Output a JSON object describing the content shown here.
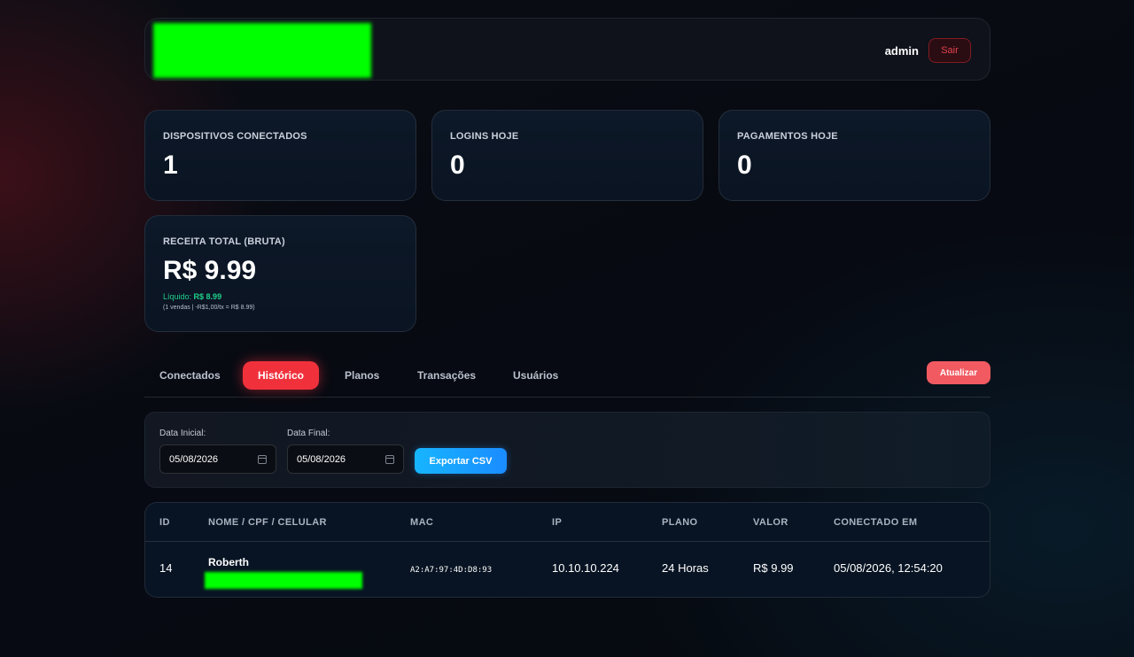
{
  "header": {
    "user": "admin",
    "logout_label": "Sair"
  },
  "stats": [
    {
      "label": "DISPOSITIVOS CONECTADOS",
      "value": "1"
    },
    {
      "label": "LOGINS HOJE",
      "value": "0"
    },
    {
      "label": "PAGAMENTOS HOJE",
      "value": "0"
    }
  ],
  "revenue": {
    "label": "RECEITA TOTAL (BRUTA)",
    "value": "R$ 9.99",
    "liquido_prefix": "Líquido:",
    "liquido_value": "R$ 8.99",
    "note": "(1 vendas | -R$1,00/tx = R$ 8.99)"
  },
  "tabs": [
    {
      "label": "Conectados",
      "active": false
    },
    {
      "label": "Histórico",
      "active": true
    },
    {
      "label": "Planos",
      "active": false
    },
    {
      "label": "Transações",
      "active": false
    },
    {
      "label": "Usuários",
      "active": false
    }
  ],
  "refresh_label": "Atualizar",
  "filters": {
    "start_label": "Data Inicial:",
    "start_value": "05/08/2026",
    "end_label": "Data Final:",
    "end_value": "05/08/2026",
    "export_label": "Exportar CSV"
  },
  "table": {
    "columns": [
      "ID",
      "NOME / CPF / CELULAR",
      "MAC",
      "IP",
      "PLANO",
      "VALOR",
      "CONECTADO EM"
    ],
    "rows": [
      {
        "id": "14",
        "name": "Roberth",
        "mac": "A2:A7:97:4D:D8:93",
        "ip": "10.10.10.224",
        "plan": "24 Horas",
        "value": "R$ 9.99",
        "connected_at": "05/08/2026, 12:54:20"
      }
    ]
  },
  "colors": {
    "accent_red": "#f0313c",
    "accent_blue": "#1a8cff",
    "liquid_green": "#1fd08a",
    "card_bg": "#0d1828"
  }
}
